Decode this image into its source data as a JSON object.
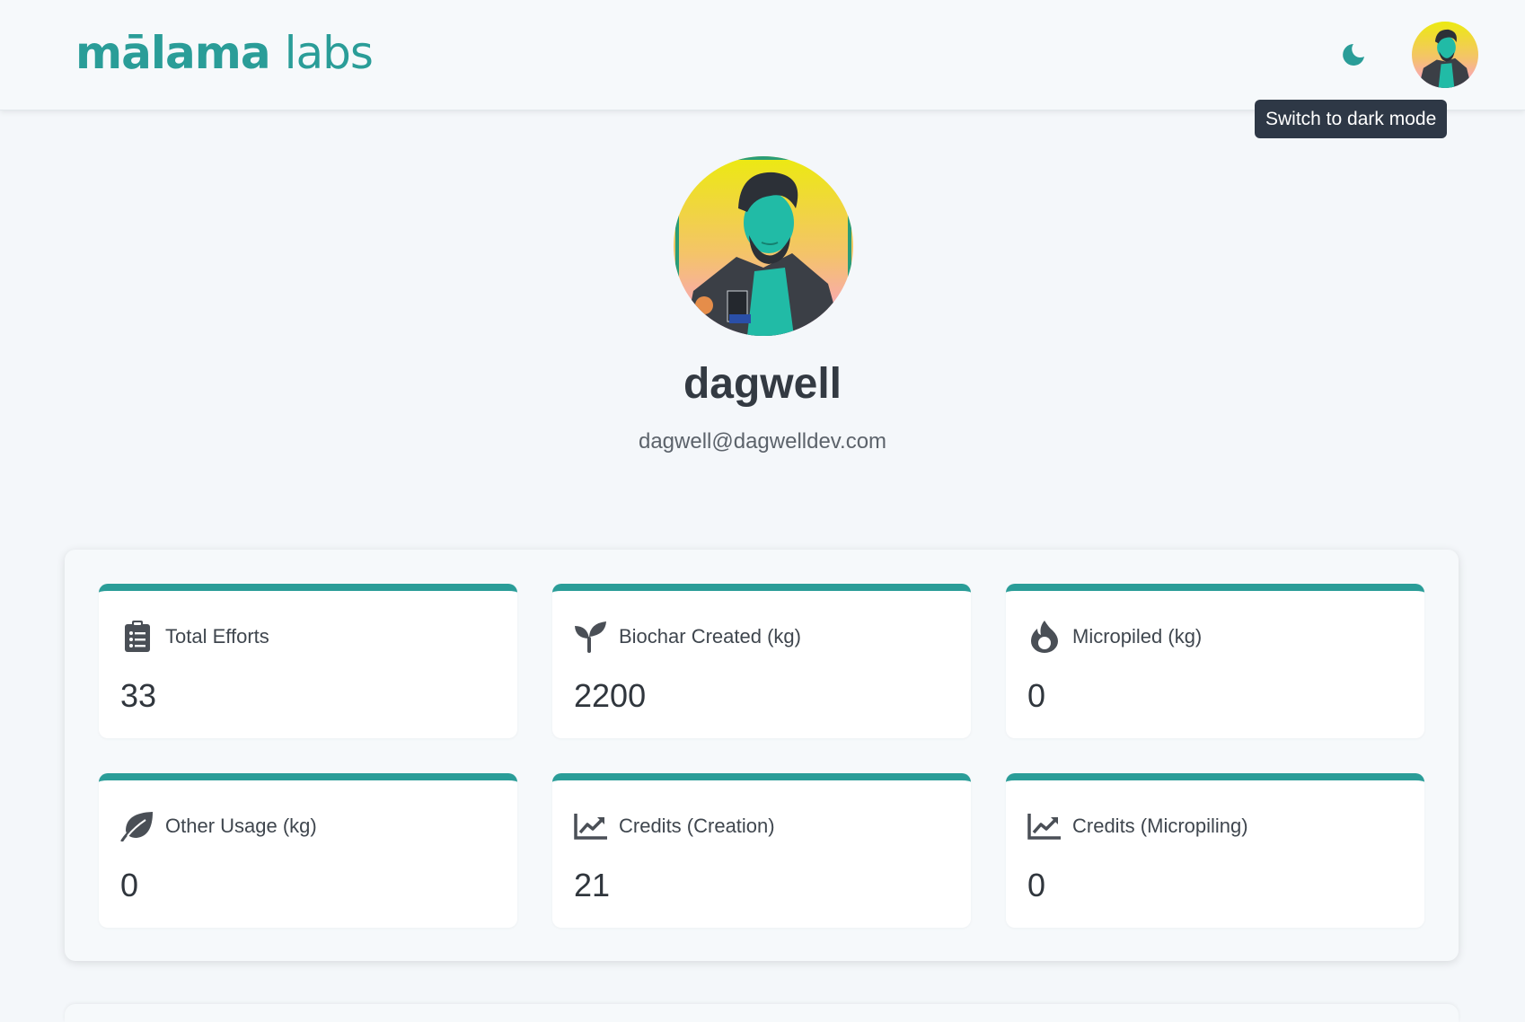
{
  "header": {
    "logo_main": "mālama",
    "logo_sub": "labs",
    "theme_tooltip": "Switch to dark mode",
    "moon_icon": "moon-icon",
    "avatar_icon": "user-avatar"
  },
  "profile": {
    "name": "dagwell",
    "email": "dagwell@dagwelldev.com"
  },
  "stats": [
    {
      "label": "Total Efforts",
      "value": "33",
      "icon": "clipboard-list-icon"
    },
    {
      "label": "Biochar Created (kg)",
      "value": "2200",
      "icon": "seedling-icon"
    },
    {
      "label": "Micropiled (kg)",
      "value": "0",
      "icon": "fire-icon"
    },
    {
      "label": "Other Usage (kg)",
      "value": "0",
      "icon": "leaf-icon"
    },
    {
      "label": "Credits (Creation)",
      "value": "21",
      "icon": "chart-line-icon"
    },
    {
      "label": "Credits (Micropiling)",
      "value": "0",
      "icon": "chart-line-icon"
    }
  ],
  "colors": {
    "accent": "#2a9d98",
    "background": "#f4f7fa",
    "card": "#ffffff",
    "tooltip_bg": "#2e3846",
    "text": "#333a42"
  }
}
